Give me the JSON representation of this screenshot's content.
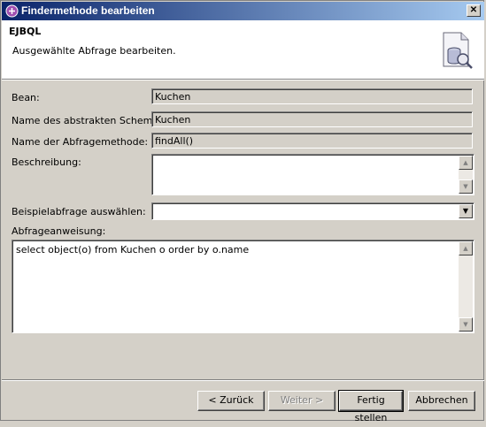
{
  "window": {
    "title": "Findermethode bearbeiten",
    "close_glyph": "✕"
  },
  "header": {
    "title": "EJBQL",
    "description": "Ausgewählte Abfrage bearbeiten."
  },
  "form": {
    "bean_label": "Bean:",
    "bean_value": "Kuchen",
    "schema_label": "Name des abstrakten Schemas:",
    "schema_value": "Kuchen",
    "method_label": "Name der Abfragemethode:",
    "method_value": "findAll()",
    "description_label": "Beschreibung:",
    "description_value": "",
    "sample_label": "Beispielabfrage auswählen:",
    "sample_value": "",
    "statement_label": "Abfrageanweisung:",
    "statement_value": "select object(o) from Kuchen o order by o.name"
  },
  "buttons": {
    "back": "< Zurück",
    "next": "Weiter >",
    "finish": "Fertig stellen",
    "cancel": "Abbrechen"
  },
  "colors": {
    "titlebar_start": "#0a246a",
    "titlebar_end": "#a6caf0",
    "dialog_bg": "#d4d0c8"
  },
  "icons": {
    "title": "wizard-app-icon",
    "header": "query-document-icon"
  }
}
